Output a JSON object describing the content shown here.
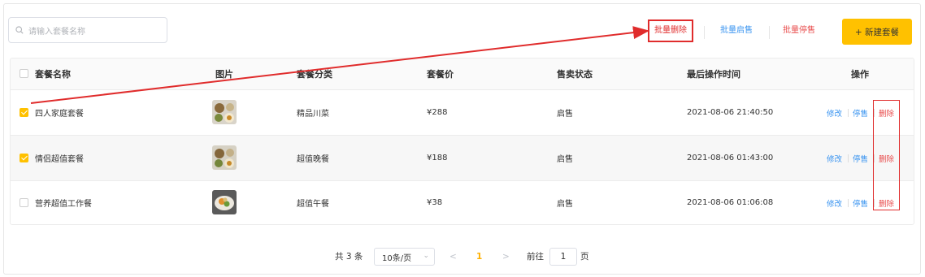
{
  "search": {
    "placeholder": "请输入套餐名称"
  },
  "toolbar": {
    "batch_delete": "批量删除",
    "batch_on": "批量启售",
    "batch_off": "批量停售",
    "new_button": "+ 新建套餐"
  },
  "table": {
    "headers": [
      "套餐名称",
      "图片",
      "套餐分类",
      "套餐价",
      "售卖状态",
      "最后操作时间",
      "操作"
    ],
    "rows": [
      {
        "name": "四人家庭套餐",
        "category": "精品川菜",
        "price": "¥288",
        "status": "启售",
        "time": "2021-08-06 21:40:50",
        "checked": true
      },
      {
        "name": "情侣超值套餐",
        "category": "超值晚餐",
        "price": "¥188",
        "status": "启售",
        "time": "2021-08-06 01:43:00",
        "checked": true
      },
      {
        "name": "营养超值工作餐",
        "category": "超值午餐",
        "price": "¥38",
        "status": "启售",
        "time": "2021-08-06 01:06:08",
        "checked": false
      }
    ],
    "actions": {
      "edit": "修改",
      "stop": "停售",
      "delete": "删除"
    }
  },
  "pagination": {
    "total": "共 3 条",
    "page_size": "10条/页",
    "prev": "<",
    "current": "1",
    "next": ">",
    "goto_label": "前往",
    "goto_value": "1",
    "page_unit": "页"
  },
  "colors": {
    "accent": "#ffc100",
    "link": "#3a94f0",
    "danger": "#e84c4c",
    "annotation": "#e02c2c"
  }
}
